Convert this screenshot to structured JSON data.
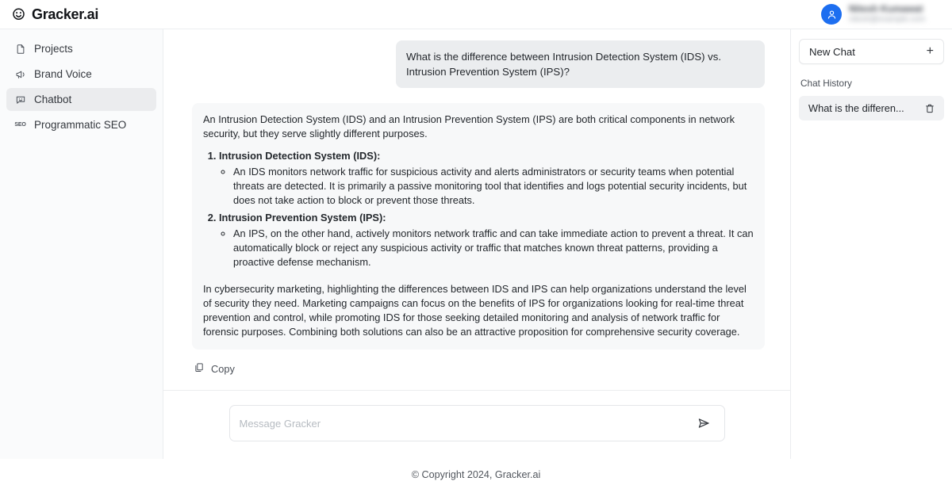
{
  "header": {
    "brand_name": "Gracker.ai",
    "brand_icon": "shield-smiley-logo-icon",
    "account": {
      "avatar_icon": "user-avatar-icon",
      "avatar_color": "#1d6ef0",
      "name_redacted": "Nitesh Kumawat",
      "email_redacted": "nitesh@example.com"
    }
  },
  "sidebar": {
    "items": [
      {
        "label": "Projects",
        "icon": "file-icon",
        "active": false
      },
      {
        "label": "Brand Voice",
        "icon": "megaphone-icon",
        "active": false
      },
      {
        "label": "Chatbot",
        "icon": "chat-smiley-icon",
        "active": true
      },
      {
        "label": "Programmatic SEO",
        "icon": "seo-icon",
        "active": false
      }
    ]
  },
  "chat": {
    "user_message": "What is the difference between Intrusion Detection System (IDS) vs. Intrusion Prevention System (IPS)?",
    "bot_message": {
      "intro": "An Intrusion Detection System (IDS) and an Intrusion Prevention System (IPS) are both critical components in network security, but they serve slightly different purposes.",
      "items": [
        {
          "heading": "Intrusion Detection System (IDS):",
          "bullets": [
            "An IDS monitors network traffic for suspicious activity and alerts administrators or security teams when potential threats are detected. It is primarily a passive monitoring tool that identifies and logs potential security incidents, but does not take action to block or prevent those threats."
          ]
        },
        {
          "heading": "Intrusion Prevention System (IPS):",
          "bullets": [
            "An IPS, on the other hand, actively monitors network traffic and can take immediate action to prevent a threat. It can automatically block or reject any suspicious activity or traffic that matches known threat patterns, providing a proactive defense mechanism."
          ]
        }
      ],
      "closing": "In cybersecurity marketing, highlighting the differences between IDS and IPS can help organizations understand the level of security they need. Marketing campaigns can focus on the benefits of IPS for organizations looking for real-time threat prevention and control, while promoting IDS for those seeking detailed monitoring and analysis of network traffic for forensic purposes. Combining both solutions can also be an attractive proposition for comprehensive security coverage."
    },
    "copy_label": "Copy",
    "copy_icon": "copy-icon"
  },
  "composer": {
    "placeholder": "Message Gracker",
    "value": "",
    "send_icon": "send-paper-plane-icon"
  },
  "right_panel": {
    "new_chat_label": "New Chat",
    "new_chat_icon": "plus-icon",
    "history_label": "Chat History",
    "history_items": [
      {
        "title": "What is the differen...",
        "delete_icon": "trash-icon"
      }
    ]
  },
  "footer": {
    "copyright": "© Copyright 2024, Gracker.ai"
  }
}
